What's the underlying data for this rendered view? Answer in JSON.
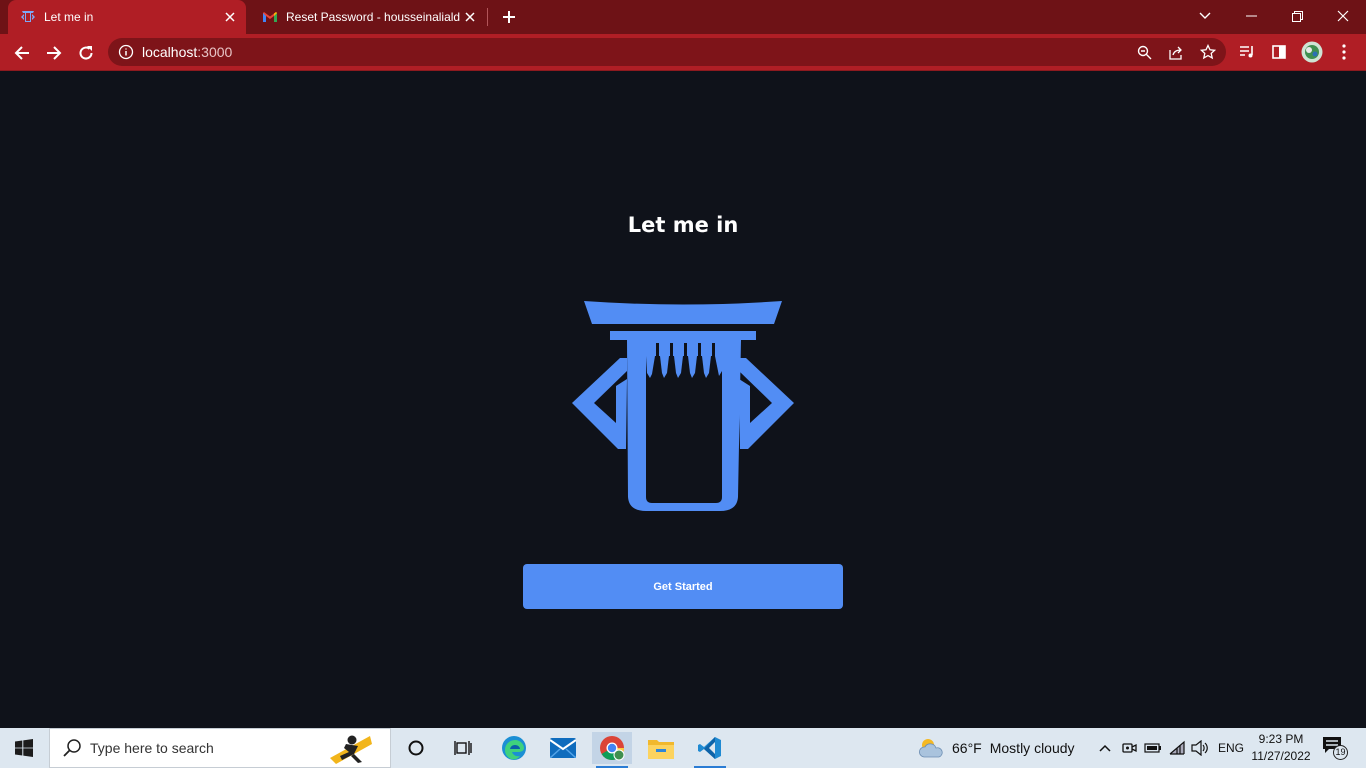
{
  "browser": {
    "tabs": [
      {
        "title": "Let me in",
        "active": true
      },
      {
        "title": "Reset Password - housseinalialdr",
        "active": false
      }
    ],
    "url": {
      "host": "localhost",
      "port": ":3000"
    },
    "accent_color": "#b01e25"
  },
  "page": {
    "title": "Let me in",
    "cta_label": "Get Started",
    "logo_color": "#528df4",
    "background_color": "#0f121a"
  },
  "taskbar": {
    "search_placeholder": "Type here to search",
    "weather_temp": "66°F",
    "weather_condition": "Mostly cloudy",
    "language": "ENG",
    "time": "9:23 PM",
    "date": "11/27/2022",
    "notification_count": "19"
  }
}
